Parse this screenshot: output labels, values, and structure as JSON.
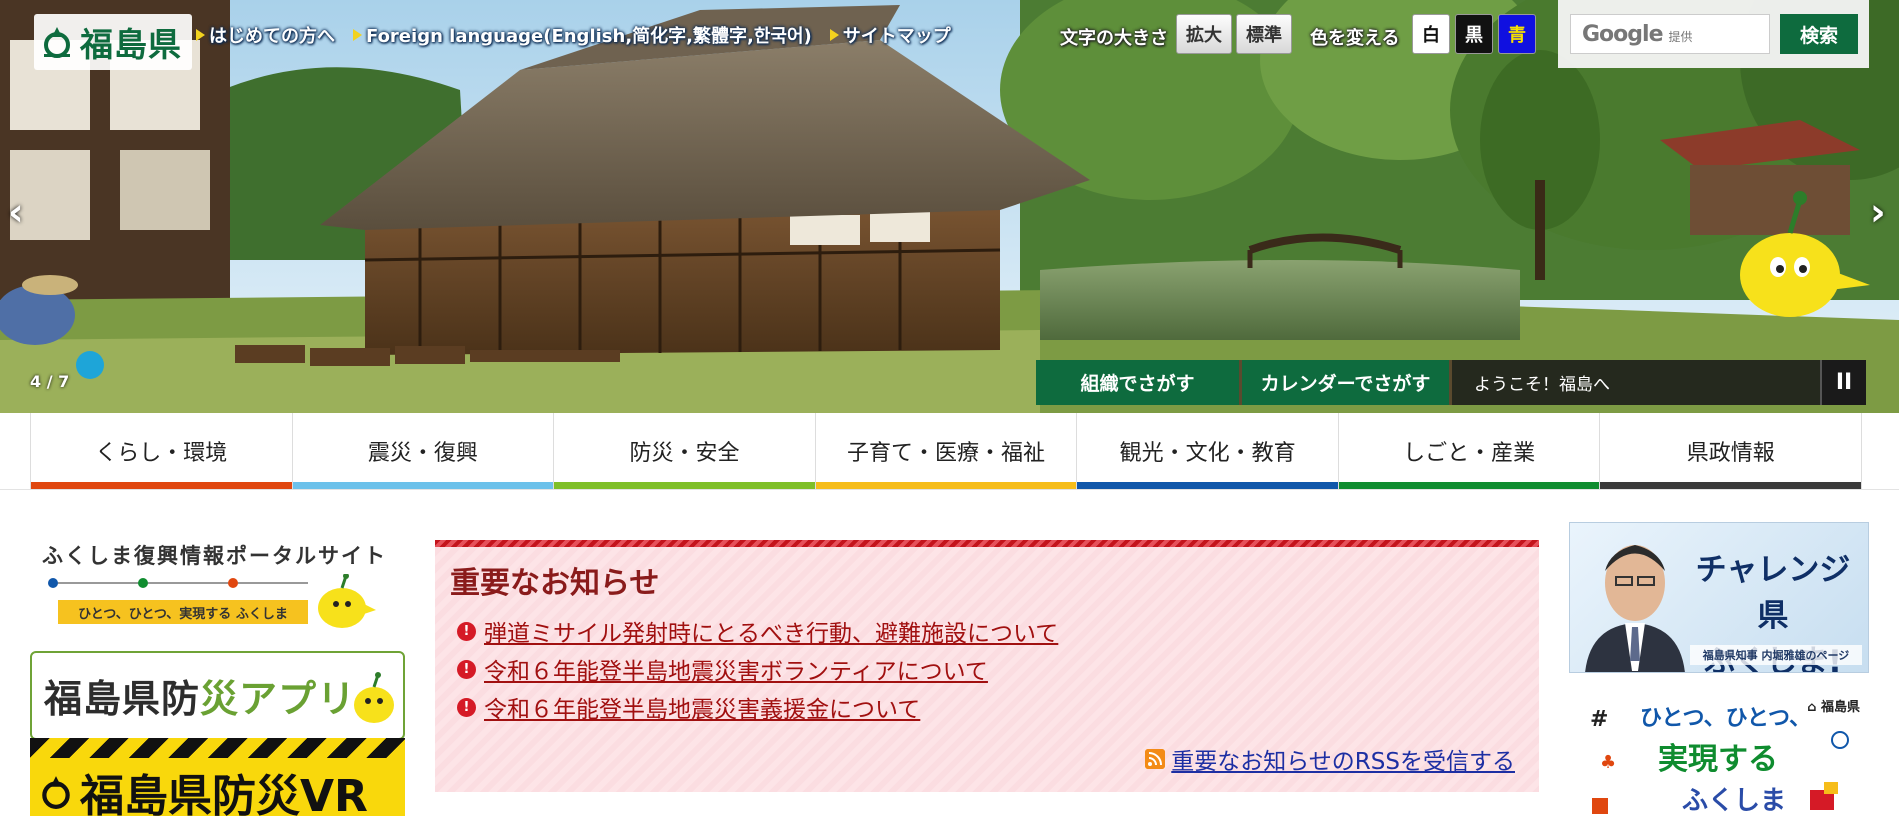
{
  "header": {
    "logo_text": "福島県",
    "links": [
      {
        "label": "はじめての方へ"
      },
      {
        "label": "Foreign language(English,简化字,繁體字,한국어)"
      },
      {
        "label": "サイトマップ"
      }
    ],
    "font_size_label": "文字の大きさ",
    "font_size_buttons": [
      "拡大",
      "標準"
    ],
    "color_label": "色を変える",
    "color_buttons": [
      {
        "label": "白",
        "bg": "#ffffff",
        "fg": "#111111"
      },
      {
        "label": "黒",
        "bg": "#111111",
        "fg": "#ffffff"
      },
      {
        "label": "青",
        "bg": "#1010e0",
        "fg": "#f7e000"
      }
    ],
    "search": {
      "brand": "Google",
      "brand_suffix": "提供",
      "button": "検索"
    }
  },
  "slider": {
    "counter": "4 / 7",
    "prev": "‹",
    "next": "›",
    "search_org": "組織でさがす",
    "search_calendar": "カレンダーでさがす",
    "welcome": "ようこそ！福島へ",
    "pause": "II"
  },
  "nav": [
    {
      "label": "くらし・環境",
      "color": "#e0470f"
    },
    {
      "label": "震災・復興",
      "color": "#6cc1ea"
    },
    {
      "label": "防災・安全",
      "color": "#7fbf28"
    },
    {
      "label": "子育て・医療・福祉",
      "color": "#f6bd1a"
    },
    {
      "label": "観光・文化・教育",
      "color": "#1057aa"
    },
    {
      "label": "しごと・産業",
      "color": "#0f8c2f"
    },
    {
      "label": "県政情報",
      "color": "#3a3a3a"
    }
  ],
  "left_banners": {
    "fukko_title": "ふくしま復興情報ポータルサイト",
    "fukko_strip": "ひとつ、ひとつ、実現する ふくしま",
    "app_title_a": "福島県防",
    "app_title_b": "災アプリ",
    "vr_title": "福島県防災VR"
  },
  "notice": {
    "title": "重要なお知らせ",
    "items": [
      "弾道ミサイル発射時にとるべき行動、避難施設について",
      "令和６年能登半島地震災害ボランティアについて",
      "令和６年能登半島地震災害義援金について"
    ],
    "rss": "重要なお知らせのRSSを受信する"
  },
  "right_banners": {
    "gov_title_1": "チャレンジ県",
    "gov_title_2": "ふくしま!",
    "gov_caption": "福島県知事 内堀雅雄のページ",
    "hito_logo": "福島県",
    "hito_line_1": "ひとつ、ひとつ、",
    "hito_line_2": "実現する",
    "hito_line_3": "ふくしま"
  }
}
